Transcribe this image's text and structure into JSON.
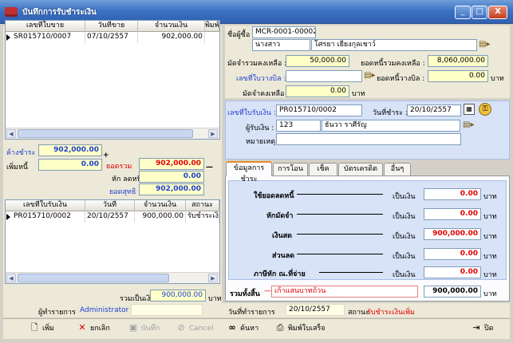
{
  "window": {
    "title": "บันทึกการรับชำระเงิน",
    "min_glyph": "_",
    "max_glyph": "□",
    "close_glyph": "X"
  },
  "invoice_grid": {
    "columns": [
      "เลขที่ใบขาย",
      "วันที่ขาย",
      "จำนวนเงิน",
      "พิมพ์"
    ],
    "rows": [
      {
        "doc_no": "SR015710/0007",
        "date": "07/10/2557",
        "amount": "902,000.00"
      }
    ]
  },
  "summary": {
    "outstanding_label": "ค้างชำระ",
    "outstanding_value": "902,000.00",
    "extra_label": "เพิ่มหนี้",
    "extra_value": "0.00",
    "total_label": "ยอดรวม",
    "total_value": "902,000.00",
    "discount_label": "หัก  ลดหนี้",
    "discount_value": "0.00",
    "net_label": "ยอดสุทธิ",
    "net_value": "902,000.00"
  },
  "receipt_grid": {
    "columns": [
      "เลขที่ใบรับเงิน",
      "วันที่",
      "จำนวนเงิน",
      "สถานะ"
    ],
    "rows": [
      {
        "doc_no": "PR015710/0002",
        "date": "20/10/2557",
        "amount": "900,000.00",
        "status": "รับชำระเงินเพิ่ม"
      }
    ]
  },
  "footer_total": {
    "label": "รวมเป็นเงิน",
    "value": "900,000.00",
    "unit": "บาท"
  },
  "customer": {
    "code_label": "ชื่อผู้ซื้อ :",
    "code_value": "MCR-0001-00002",
    "title_value": "นางสาว",
    "name_value": "โศรยา เยียงกุลเชาว์",
    "deposit_label": "มัดจำรวมคงเหลือ :",
    "deposit_value": "50,000.00",
    "debt_label": "ยอดหนี้รวมคงเหลือ :",
    "debt_value": "8,060,000.00",
    "bill_label": "เลขที่ใบวางบิล :",
    "bill_value": "",
    "bill_debt_label": "ยอดหนี้วางบิล :",
    "bill_debt_value": "0.00",
    "bill_debt_unit": "บาท",
    "deposit_left_label": "มัดจำคงเหลือ :",
    "deposit_left_value": "0.00",
    "deposit_left_unit": "บาท"
  },
  "receipt": {
    "no_label": "เลขที่ใบรับเงิน :",
    "no_value": "PR015710/0002",
    "date_label": "วันที่ชำระ :",
    "date_value": "20/10/2557",
    "receiver_label": "ผู้รับเงิน :",
    "receiver_code": "123",
    "receiver_name": "ธันวา ราศีรัญ",
    "note_label": "หมายเหตุ :",
    "note_value": ""
  },
  "tabs": [
    {
      "label": "ข้อมูลการชำระ"
    },
    {
      "label": "การโอน"
    },
    {
      "label": "เช็ค"
    },
    {
      "label": "บัตรเครดิต"
    },
    {
      "label": "อื่นๆ"
    }
  ],
  "payment": {
    "rows": [
      {
        "label": "ใช้ยอดลดหนี้",
        "as_label": "เป็นเงิน",
        "value": "0.00",
        "unit": "บาท"
      },
      {
        "label": "หักมัดจำ",
        "as_label": "เป็นเงิน",
        "value": "0.00",
        "unit": "บาท"
      },
      {
        "label": "เงินสด",
        "as_label": "เป็นเงิน",
        "value": "900,000.00",
        "unit": "บาท"
      },
      {
        "label": "ส่วนลด",
        "as_label": "เป็นเงิน",
        "value": "0.00",
        "unit": "บาท"
      },
      {
        "label": "ภาษีหัก ณ.ที่จ่าย",
        "as_label": "เป็นเงิน",
        "value": "0.00",
        "unit": "บาท"
      }
    ],
    "total_label": "รวมทั้งสิ้น",
    "total_text": "เก้าแสนบาทถ้วน",
    "total_value": "900,000.00",
    "total_unit": "บาท"
  },
  "status_bar": {
    "operator_label": "ผู้ทำรายการ",
    "operator_value": "Administrator",
    "date_label": "วันที่ทำรายการ",
    "date_value": "20/10/2557",
    "status_label": "สถานะ",
    "status_value": "รับชำระเงินเพิ่ม"
  },
  "toolbar": {
    "add": "เพิ่ม",
    "cancel_doc": "ยกเลิก",
    "save": "บันทึก",
    "cancel": "Cancel",
    "search": "ค้นหา",
    "print": "พิมพ์ใบเสร็จ",
    "close": "ปิด"
  },
  "colors": {
    "title_bar": "#3c72c4",
    "link_blue": "#1f3fd0",
    "alert_red": "#e00000",
    "field_yellow": "#ffffc8"
  }
}
